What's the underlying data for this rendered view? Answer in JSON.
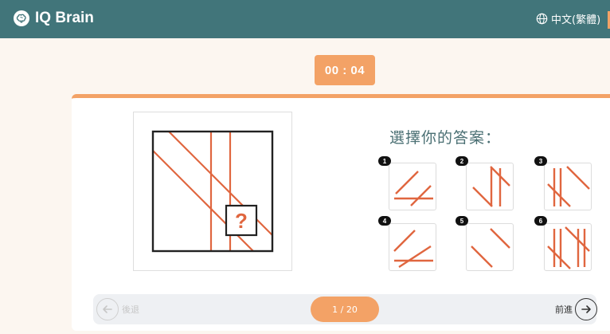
{
  "header": {
    "brand": "IQ Brain",
    "logo_icon": "brain-icon",
    "language": "中文(繁體)",
    "language_icon": "globe-icon"
  },
  "timer": {
    "value": "00 : 04"
  },
  "question": {
    "prompt": "選擇你的答案：",
    "puzzle_mark": "?",
    "line_color": "#e0663f",
    "options": [
      {
        "label": "1"
      },
      {
        "label": "2"
      },
      {
        "label": "3"
      },
      {
        "label": "4"
      },
      {
        "label": "5"
      },
      {
        "label": "6"
      }
    ]
  },
  "navigation": {
    "back_label": "後退",
    "back_icon": "arrow-left-icon",
    "progress": "1 / 20",
    "next_label": "前進",
    "next_icon": "arrow-right-icon"
  },
  "colors": {
    "header": "#41757a",
    "accent": "#f3a266",
    "background": "#fcf6f0"
  }
}
